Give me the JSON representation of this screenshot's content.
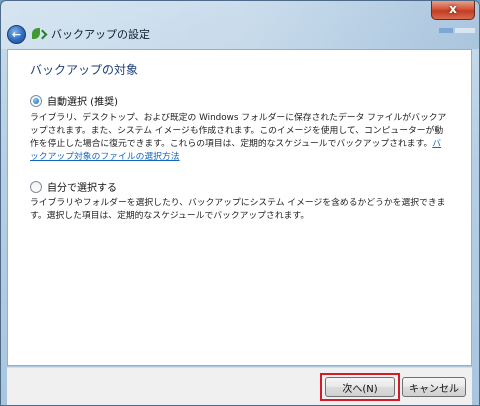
{
  "window": {
    "title": "バックアップの設定",
    "close_label": "x"
  },
  "nav": {
    "back_label": "←"
  },
  "content": {
    "heading": "バックアップの対象",
    "options": [
      {
        "label": "自動選択 (推奨)",
        "selected": true,
        "description": "ライブラリ、デスクトップ、および既定の Windows フォルダーに保存されたデータ ファイルがバックアップされます。また、システム イメージも作成されます。このイメージを使用して、コンピューターが動作を停止した場合に復元できます。これらの項目は、定期的なスケジュールでバックアップされます。",
        "link": "バックアップ対象のファイルの選択方法"
      },
      {
        "label": "自分で選択する",
        "selected": false,
        "description": "ライブラリやフォルダーを選択したり、バックアップにシステム イメージを含めるかどうかを選択できます。選択した項目は、定期的なスケジュールでバックアップされます。"
      }
    ]
  },
  "footer": {
    "next_label": "次へ(N)",
    "cancel_label": "キャンセル"
  },
  "colors": {
    "heading": "#1e3f7a",
    "link": "#1565c0",
    "highlight": "#d21c2a"
  }
}
